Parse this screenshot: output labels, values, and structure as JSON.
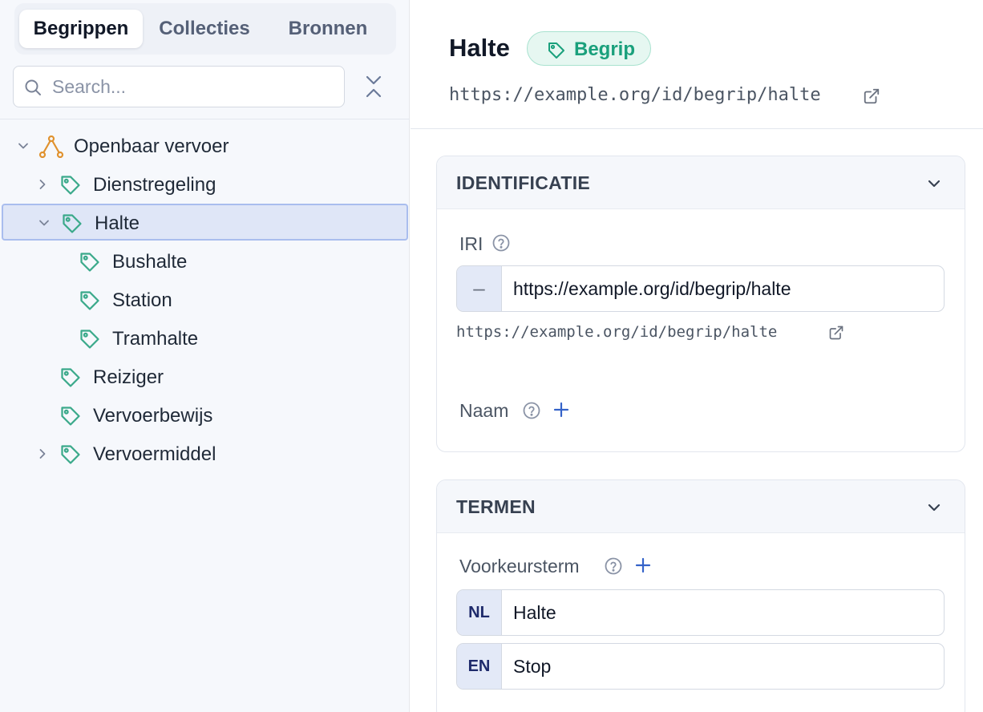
{
  "sidebar": {
    "tabs": [
      {
        "label": "Begrippen",
        "active": true
      },
      {
        "label": "Collecties",
        "active": false
      },
      {
        "label": "Bronnen",
        "active": false
      }
    ],
    "search": {
      "placeholder": "Search...",
      "value": ""
    },
    "tree": [
      {
        "label": "Openbaar vervoer",
        "icon": "scheme-icon",
        "chevron": "down",
        "depth": 0
      },
      {
        "label": "Dienstregeling",
        "icon": "tag-icon",
        "chevron": "right",
        "depth": 1
      },
      {
        "label": "Halte",
        "icon": "tag-icon",
        "chevron": "down",
        "depth": 1,
        "selected": true
      },
      {
        "label": "Bushalte",
        "icon": "tag-icon",
        "chevron": "none",
        "depth": 2
      },
      {
        "label": "Station",
        "icon": "tag-icon",
        "chevron": "none",
        "depth": 2
      },
      {
        "label": "Tramhalte",
        "icon": "tag-icon",
        "chevron": "none",
        "depth": 2
      },
      {
        "label": "Reiziger",
        "icon": "tag-icon",
        "chevron": "none",
        "depth": 1
      },
      {
        "label": "Vervoerbewijs",
        "icon": "tag-icon",
        "chevron": "none",
        "depth": 1
      },
      {
        "label": "Vervoermiddel",
        "icon": "tag-icon",
        "chevron": "right",
        "depth": 1
      }
    ]
  },
  "header": {
    "title": "Halte",
    "badge": "Begrip",
    "iri": "https://example.org/id/begrip/halte"
  },
  "identificatie": {
    "title": "IDENTIFICATIE",
    "iri_label": "IRI",
    "iri_addon": "–",
    "iri_value": "https://example.org/id/begrip/halte",
    "iri_preview": "https://example.org/id/begrip/halte",
    "naam_label": "Naam"
  },
  "termen": {
    "title": "TERMEN",
    "voorkeursterm_label": "Voorkeursterm",
    "terms": [
      {
        "lang": "NL",
        "value": "Halte"
      },
      {
        "lang": "EN",
        "value": "Stop"
      }
    ]
  },
  "colors": {
    "accent_green": "#1aa07c",
    "tag_green": "#3aa98a",
    "scheme_orange": "#e0922f",
    "selected_bg": "#dfe6f7",
    "selected_border": "#a9bdee",
    "link_blue": "#3563c9"
  }
}
